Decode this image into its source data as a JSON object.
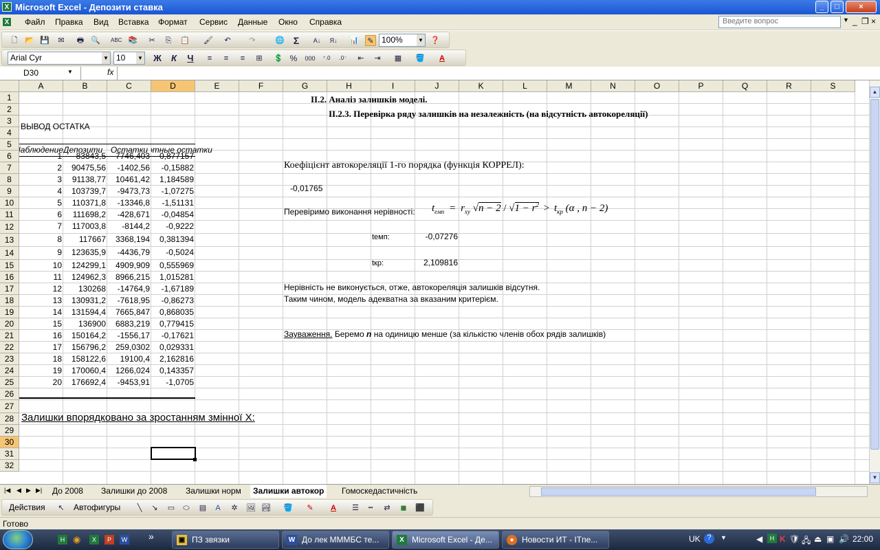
{
  "window": {
    "title": "Microsoft Excel - Депозити ставка",
    "btn_min": "_",
    "btn_max": "□",
    "btn_close": "×"
  },
  "menu": {
    "items": [
      "Файл",
      "Правка",
      "Вид",
      "Вставка",
      "Формат",
      "Сервис",
      "Данные",
      "Окно",
      "Справка"
    ],
    "ask_placeholder": "Введите вопрос"
  },
  "toolbar": {
    "zoom": "100%",
    "font": "Arial Cyr",
    "size": "10",
    "bold": "Ж",
    "italic": "К",
    "underline": "Ч",
    "percent": "%",
    "thousands": "000"
  },
  "formula_bar": {
    "name_box": "D30",
    "fx": "fx",
    "content": ""
  },
  "columns": [
    "A",
    "B",
    "C",
    "D",
    "E",
    "F",
    "G",
    "H",
    "I",
    "J",
    "K",
    "L",
    "M",
    "N",
    "O",
    "P",
    "Q",
    "R",
    "S"
  ],
  "rows": [
    "1",
    "2",
    "3",
    "4",
    "5",
    "6",
    "7",
    "8",
    "9",
    "10",
    "11",
    "12",
    "13",
    "14",
    "15",
    "16",
    "17",
    "18",
    "19",
    "20",
    "21",
    "22",
    "23",
    "24",
    "25",
    "26",
    "27",
    "28",
    "29",
    "30",
    "31",
    "32"
  ],
  "sheet": {
    "title1": "II.2. Аналіз залишків моделі.",
    "title2": "II.2.3. Перевірка ряду залишків на незалежність (на відсутність автокореляції)",
    "vyvod": "ВЫВОД ОСТАТКА",
    "headers": [
      "Наблюдение",
      "Депозити",
      "Остатки",
      "Стандартные остатки"
    ],
    "table": [
      [
        "1",
        "83843,5",
        "7746,403",
        "0,877157"
      ],
      [
        "2",
        "90475,56",
        "-1402,56",
        "-0,15882"
      ],
      [
        "3",
        "91138,77",
        "10461,42",
        "1,184589"
      ],
      [
        "4",
        "103739,7",
        "-9473,73",
        "-1,07275"
      ],
      [
        "5",
        "110371,8",
        "-13346,8",
        "-1,51131"
      ],
      [
        "6",
        "111698,2",
        "-428,671",
        "-0,04854"
      ],
      [
        "7",
        "117003,8",
        "-8144,2",
        "-0,9222"
      ],
      [
        "8",
        "117667",
        "3368,194",
        "0,381394"
      ],
      [
        "9",
        "123635,9",
        "-4436,79",
        "-0,5024"
      ],
      [
        "10",
        "124299,1",
        "4909,909",
        "0,555969"
      ],
      [
        "11",
        "124962,3",
        "8966,215",
        "1,015281"
      ],
      [
        "12",
        "130268",
        "-14764,9",
        "-1,67189"
      ],
      [
        "13",
        "130931,2",
        "-7618,95",
        "-0,86273"
      ],
      [
        "14",
        "131594,4",
        "7665,847",
        "0,868035"
      ],
      [
        "15",
        "136900",
        "6883,219",
        "0,779415"
      ],
      [
        "16",
        "150164,2",
        "-1556,17",
        "-0,17621"
      ],
      [
        "17",
        "156796,2",
        "259,0302",
        "0,029331"
      ],
      [
        "18",
        "158122,6",
        "19100,4",
        "2,162816"
      ],
      [
        "19",
        "170060,4",
        "1266,024",
        "0,143357"
      ],
      [
        "20",
        "176692,4",
        "-9453,91",
        "-1,0705"
      ]
    ],
    "coef_label": "Коефіцієнт автокореляції 1-го порядка (функція КОРРЕЛ):",
    "coef_value": "-0,01765",
    "check_label": "Перевіримо виконання нерівності:",
    "t_emp_label": "tемп:",
    "t_emp_value": "-0,07276",
    "t_kr_label": "tкр:",
    "t_kr_value": "2,109816",
    "conclusion1": "Нерівність не виконується, отже, автокореляція залишків відсутня.",
    "conclusion2": "Таким чином, модель адекватна за вказаним критерієм.",
    "note_label": "Зауваження.",
    "note_text1": "Беремо",
    "note_n": "n",
    "note_text2": "на одиницю менше (за кількістю членів обох рядів залишків)",
    "sorted_label": "Залишки впорядковано за зростанням змінної X:"
  },
  "formula": {
    "t": "t",
    "emp": "емп",
    "eq": "=",
    "r": "r",
    "xy": "xy",
    "sqrt1": "n − 2",
    "slash": "/",
    "sqrt2": "1 − r",
    "two": "2",
    "gt": ">",
    "kr": "кр",
    "args": "(α , n − 2)"
  },
  "tabs": [
    "До 2008",
    "Залишки до 2008",
    "Залишки норм",
    "Залишки автокор",
    "Гомоскедастичність"
  ],
  "drawbar": {
    "actions": "Действия",
    "autoshapes": "Автофигуры"
  },
  "status": {
    "text": "Готово"
  },
  "taskbar": {
    "items": [
      "ПЗ звязки",
      "До лек МММБС те...",
      "Microsoft Excel - Де...",
      "Новости ИТ - ITпе..."
    ],
    "lang": "UK",
    "time": "22:00",
    "chev": "»"
  }
}
